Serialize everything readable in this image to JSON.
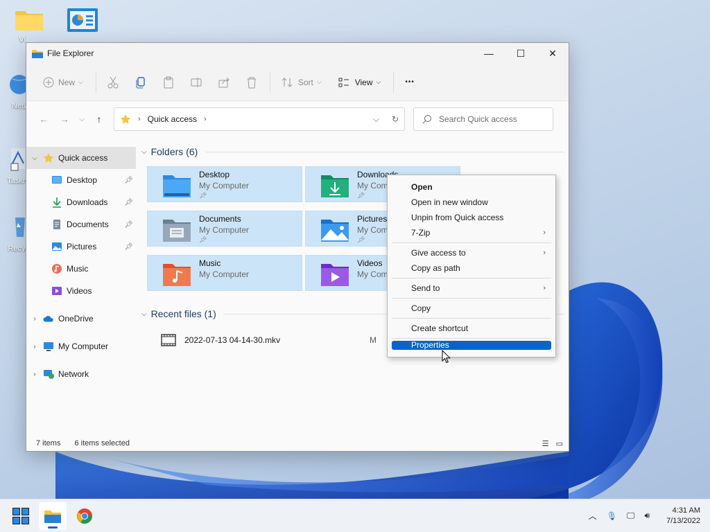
{
  "desktop": {
    "icons": [
      {
        "label": "Vi",
        "icon": "folder-icon"
      },
      {
        "label": "",
        "icon": "control-panel-icon"
      },
      {
        "label": "Netw",
        "icon": "network-globe-icon"
      },
      {
        "label": "Taskm",
        "icon": "shortcut-icon"
      },
      {
        "label": "Recyc",
        "icon": "recycle-bin-icon"
      }
    ]
  },
  "window": {
    "title": "File Explorer",
    "controls": {
      "minimize": "—",
      "maximize": "☐",
      "close": "✕"
    }
  },
  "toolbar": {
    "new_label": "New",
    "sort_label": "Sort",
    "view_label": "View",
    "more_label": "•••"
  },
  "address": {
    "location": "Quick access",
    "search_placeholder": "Search Quick access"
  },
  "sidebar": {
    "items": [
      {
        "label": "Quick access",
        "icon": "star-icon",
        "expanded": true,
        "selected": true
      },
      {
        "label": "Desktop",
        "icon": "desktop-icon",
        "pinned": true
      },
      {
        "label": "Downloads",
        "icon": "download-icon",
        "pinned": true
      },
      {
        "label": "Documents",
        "icon": "documents-icon",
        "pinned": true
      },
      {
        "label": "Pictures",
        "icon": "pictures-icon",
        "pinned": true
      },
      {
        "label": "Music",
        "icon": "music-icon"
      },
      {
        "label": "Videos",
        "icon": "videos-icon"
      },
      {
        "label": "OneDrive",
        "icon": "cloud-icon"
      },
      {
        "label": "My Computer",
        "icon": "computer-icon"
      },
      {
        "label": "Network",
        "icon": "network-icon"
      }
    ]
  },
  "content": {
    "folders_header": "Folders (6)",
    "folders": [
      {
        "name": "Desktop",
        "location": "My Computer"
      },
      {
        "name": "Downloads",
        "location": "My Com"
      },
      {
        "name": "Documents",
        "location": "My Computer"
      },
      {
        "name": "Pictures",
        "location": "My Com"
      },
      {
        "name": "Music",
        "location": "My Computer"
      },
      {
        "name": "Videos",
        "location": "My Com"
      }
    ],
    "recent_header": "Recent files (1)",
    "recent": [
      {
        "name": "2022-07-13 04-14-30.mkv",
        "location": "M"
      }
    ]
  },
  "status": {
    "count": "7 items",
    "selected": "6 items selected"
  },
  "context_menu": {
    "items": [
      {
        "label": "Open",
        "bold": true
      },
      {
        "label": "Open in new window"
      },
      {
        "label": "Unpin from Quick access"
      },
      {
        "label": "7-Zip",
        "submenu": true
      },
      {
        "label": "Give access to",
        "submenu": true
      },
      {
        "label": "Copy as path"
      },
      {
        "label": "Send to",
        "submenu": true
      },
      {
        "label": "Copy"
      },
      {
        "label": "Create shortcut"
      },
      {
        "label": "Properties",
        "highlighted": true
      }
    ]
  },
  "taskbar": {
    "time": "4:31 AM",
    "date": "7/13/2022"
  },
  "colors": {
    "accent": "#0a64c8",
    "tile_selected": "#cce4f7",
    "folder_yellow": "#f5c542"
  }
}
